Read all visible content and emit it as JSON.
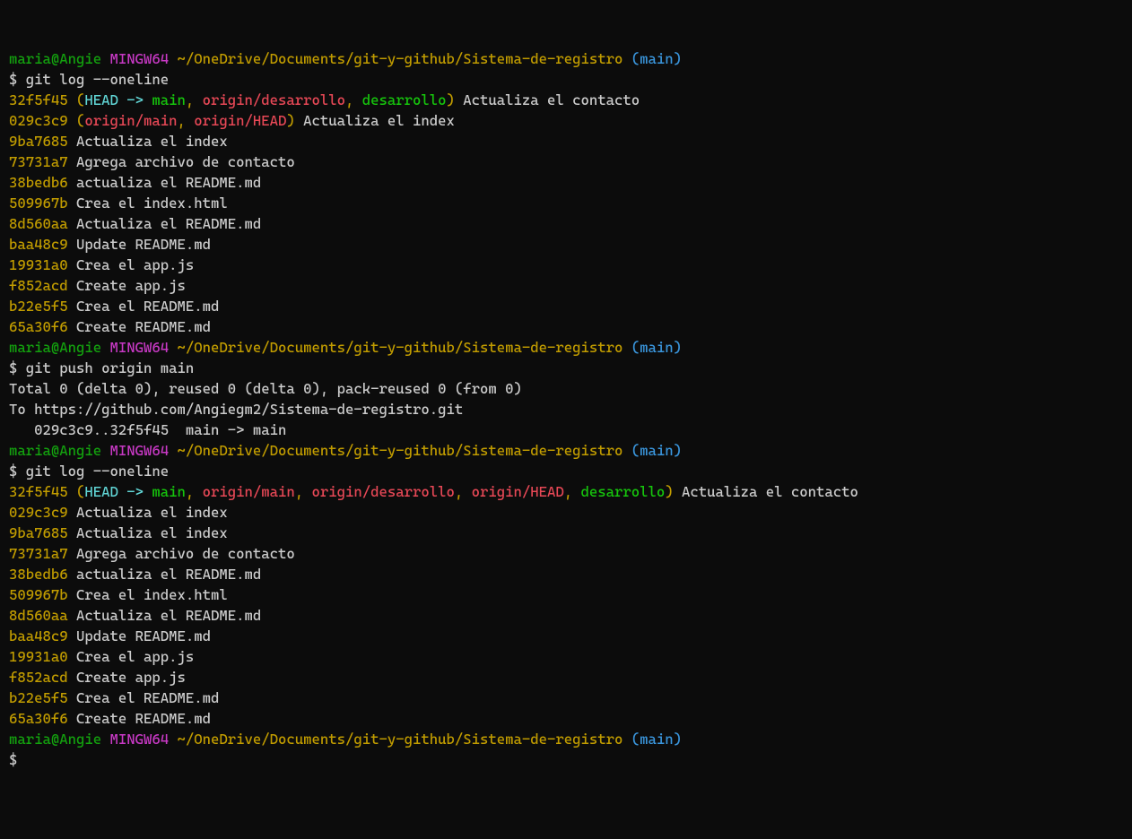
{
  "prompt": {
    "user_host": "maria@Angie",
    "shell": "MINGW64",
    "cwd": "~/OneDrive/Documents/git-y-github/Sistema-de-registro",
    "branch_open": "(",
    "branch": "main",
    "branch_close": ")",
    "ps1": "$"
  },
  "cmd1": "git log --oneline",
  "log1": [
    {
      "hash": "32f5f45",
      "refs": {
        "open": "(",
        "head": "HEAD -> ",
        "main": "main",
        "sep1": ", ",
        "r1": "origin/desarrollo",
        "sep2": ", ",
        "r2": "desarrollo",
        "close": ")"
      },
      "msg": " Actualiza el contacto"
    },
    {
      "hash": "029c3c9",
      "refs": {
        "open": "(",
        "r1": "origin/main",
        "sep1": ", ",
        "r2": "origin/HEAD",
        "close": ")"
      },
      "msg": " Actualiza el index"
    },
    {
      "hash": "9ba7685",
      "msg": " Actualiza el index"
    },
    {
      "hash": "73731a7",
      "msg": " Agrega archivo de contacto"
    },
    {
      "hash": "38bedb6",
      "msg": " actualiza el README.md"
    },
    {
      "hash": "509967b",
      "msg": " Crea el index.html"
    },
    {
      "hash": "8d560aa",
      "msg": " Actualiza el README.md"
    },
    {
      "hash": "baa48c9",
      "msg": " Update README.md"
    },
    {
      "hash": "19931a0",
      "msg": " Crea el app.js"
    },
    {
      "hash": "f852acd",
      "msg": " Create app.js"
    },
    {
      "hash": "b22e5f5",
      "msg": " Crea el README.md"
    },
    {
      "hash": "65a30f6",
      "msg": " Create README.md"
    }
  ],
  "cmd2": "git push origin main",
  "push_out": {
    "l1": "Total 0 (delta 0), reused 0 (delta 0), pack-reused 0 (from 0)",
    "l2": "To https://github.com/Angiegm2/Sistema-de-registro.git",
    "l3": "   029c3c9..32f5f45  main -> main"
  },
  "cmd3": "git log --oneline",
  "log2_first": {
    "hash": "32f5f45",
    "open": "(",
    "head": "HEAD -> ",
    "main": "main",
    "sep1": ", ",
    "r1": "origin/main",
    "sep2": ", ",
    "r2": "origin/desarrollo",
    "sep3": ", ",
    "r3": "origin/HEAD",
    "sep4": ", ",
    "r4": "desarrollo",
    "close": ")",
    "msg": " Actualiza el contacto"
  },
  "log2": [
    {
      "hash": "029c3c9",
      "msg": " Actualiza el index"
    },
    {
      "hash": "9ba7685",
      "msg": " Actualiza el index"
    },
    {
      "hash": "73731a7",
      "msg": " Agrega archivo de contacto"
    },
    {
      "hash": "38bedb6",
      "msg": " actualiza el README.md"
    },
    {
      "hash": "509967b",
      "msg": " Crea el index.html"
    },
    {
      "hash": "8d560aa",
      "msg": " Actualiza el README.md"
    },
    {
      "hash": "baa48c9",
      "msg": " Update README.md"
    },
    {
      "hash": "19931a0",
      "msg": " Crea el app.js"
    },
    {
      "hash": "f852acd",
      "msg": " Create app.js"
    },
    {
      "hash": "b22e5f5",
      "msg": " Crea el README.md"
    },
    {
      "hash": "65a30f6",
      "msg": " Create README.md"
    }
  ]
}
